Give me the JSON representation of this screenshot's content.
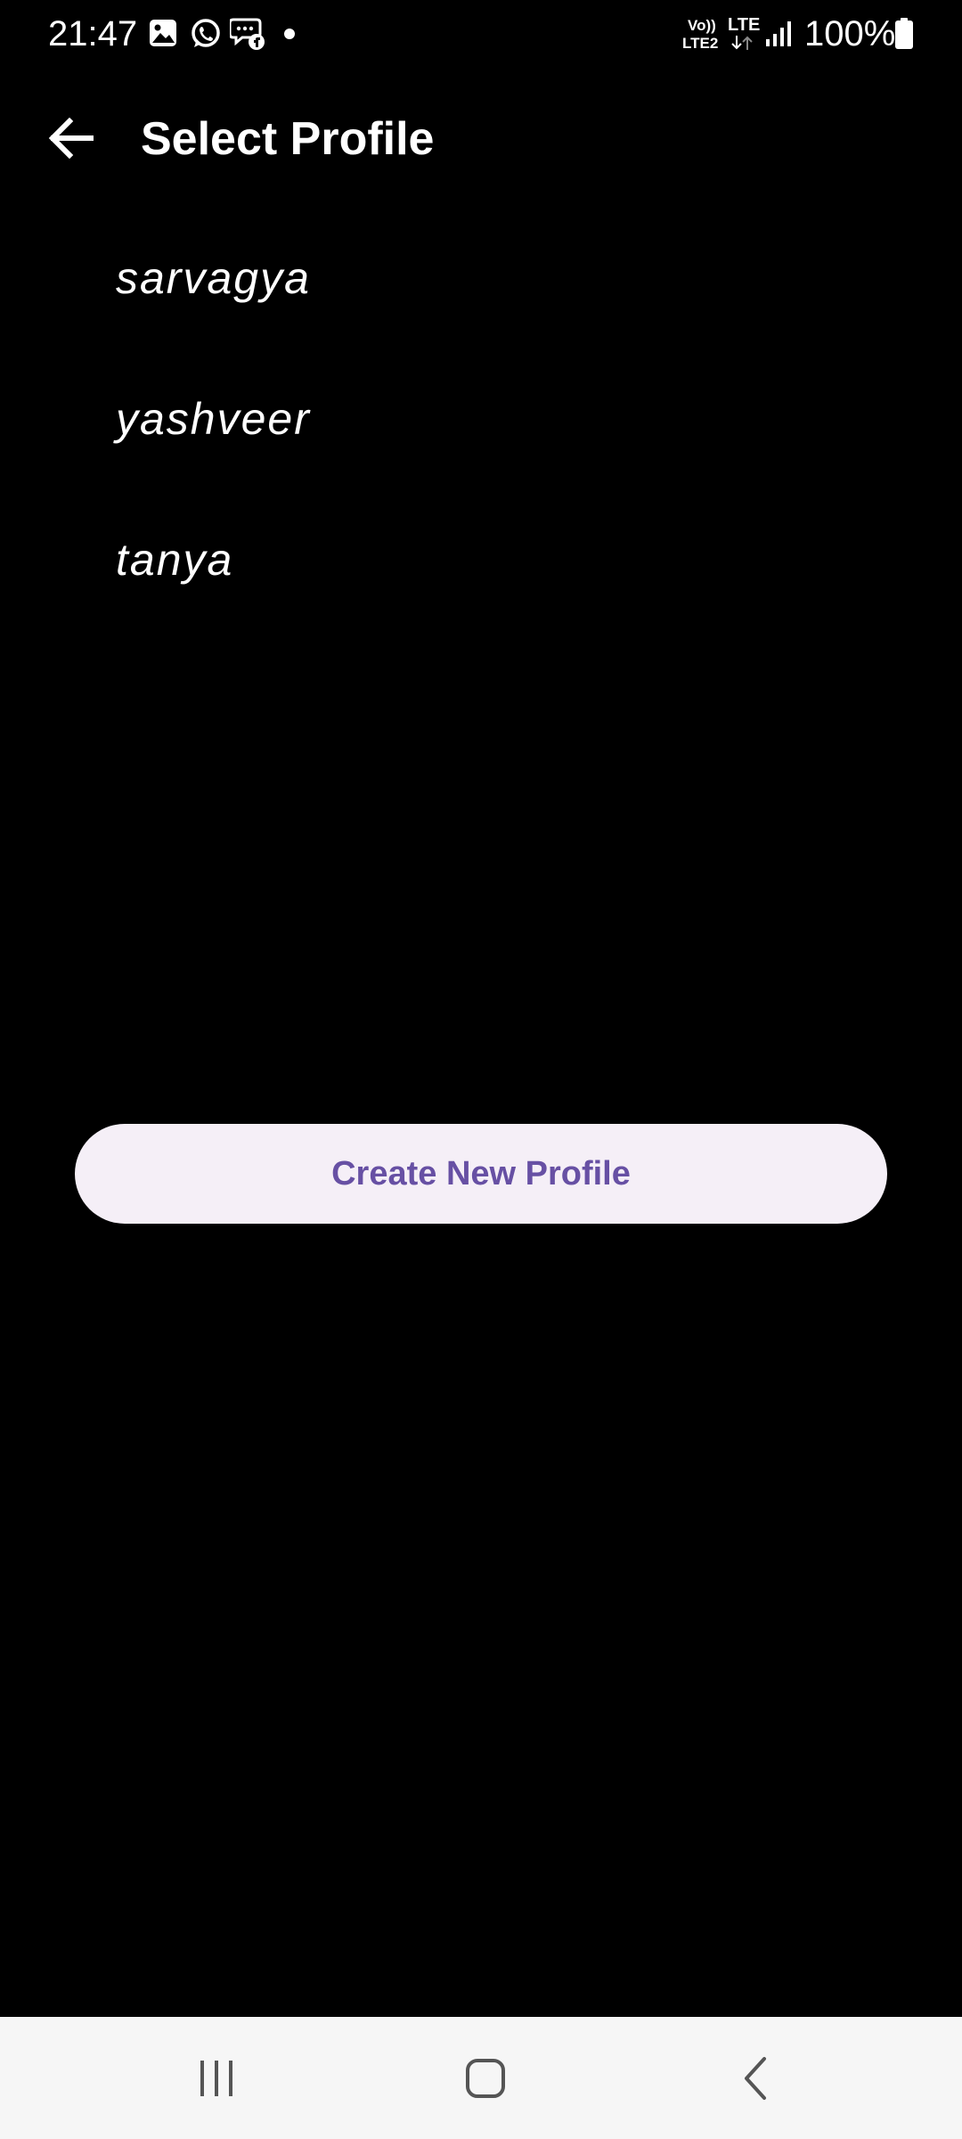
{
  "status_bar": {
    "time": "21:47",
    "notification_icons": [
      "gallery-icon",
      "whatsapp-icon",
      "messenger-icon",
      "dot-icon"
    ],
    "volte_top": "Vo))",
    "volte_bottom": "LTE2",
    "network_type": "LTE",
    "battery_percent": "100%"
  },
  "app_bar": {
    "back_icon": "arrow-back-icon",
    "title": "Select Profile"
  },
  "profiles": {
    "items": [
      {
        "label": "sarvagya"
      },
      {
        "label": "yashveer"
      },
      {
        "label": "tanya"
      }
    ]
  },
  "actions": {
    "create_label": "Create New Profile"
  },
  "navigation_bar": {
    "icons": [
      "recents-icon",
      "home-icon",
      "back-icon"
    ]
  },
  "colors": {
    "background": "#000000",
    "button_background": "#f5eff7",
    "button_text": "#6750a4",
    "nav_bar_background": "#f6f6f6",
    "nav_icon": "#555555"
  }
}
